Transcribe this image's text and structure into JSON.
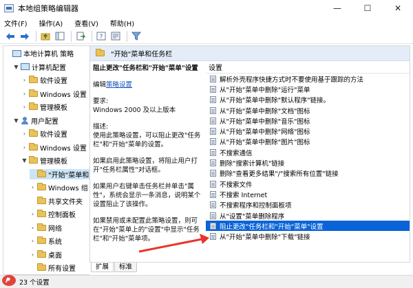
{
  "window": {
    "title": "本地组策略编辑器",
    "minimize": "—",
    "maximize": "☐",
    "close": "✕"
  },
  "menu": [
    "文件(F)",
    "操作(A)",
    "查看(V)",
    "帮助(H)"
  ],
  "toolbar": {
    "icons": [
      "back-arrow-icon",
      "forward-arrow-icon",
      "up-folder-icon",
      "show-hide-tree-icon",
      "export-list-icon",
      "help-icon",
      "properties-icon",
      "filter-icon"
    ]
  },
  "tree": {
    "items": [
      {
        "label": "本地计算机 策略",
        "indent": 0,
        "twisty": "",
        "icon": "pc"
      },
      {
        "label": "计算机配置",
        "indent": 1,
        "twisty": "▼",
        "icon": "pc"
      },
      {
        "label": "软件设置",
        "indent": 2,
        "twisty": "›",
        "icon": "folder"
      },
      {
        "label": "Windows 设置",
        "indent": 2,
        "twisty": "›",
        "icon": "folder"
      },
      {
        "label": "管理模板",
        "indent": 2,
        "twisty": "›",
        "icon": "folder"
      },
      {
        "label": "用户配置",
        "indent": 1,
        "twisty": "▼",
        "icon": "user"
      },
      {
        "label": "软件设置",
        "indent": 2,
        "twisty": "›",
        "icon": "folder"
      },
      {
        "label": "Windows 设置",
        "indent": 2,
        "twisty": "›",
        "icon": "folder"
      },
      {
        "label": "管理模板",
        "indent": 2,
        "twisty": "▼",
        "icon": "folder"
      },
      {
        "label": "\"开始\"菜单和",
        "indent": 3,
        "twisty": "",
        "icon": "folder",
        "selected": true
      },
      {
        "label": "Windows 组",
        "indent": 3,
        "twisty": "›",
        "icon": "folder"
      },
      {
        "label": "共享文件夹",
        "indent": 3,
        "twisty": "",
        "icon": "folder"
      },
      {
        "label": "控制面板",
        "indent": 3,
        "twisty": "›",
        "icon": "folder"
      },
      {
        "label": "网络",
        "indent": 3,
        "twisty": "›",
        "icon": "folder"
      },
      {
        "label": "系统",
        "indent": 3,
        "twisty": "›",
        "icon": "folder"
      },
      {
        "label": "桌面",
        "indent": 3,
        "twisty": "›",
        "icon": "folder"
      },
      {
        "label": "所有设置",
        "indent": 3,
        "twisty": "",
        "icon": "folder"
      }
    ]
  },
  "main": {
    "header": "\"开始\"菜单和任务栏",
    "desc_title": "阻止更改\"任务栏和\"开始\"菜单\"设置",
    "edit_prefix": "编辑",
    "edit_link": "策略设置",
    "req_label": "要求:",
    "req_value": "Windows 2000 及以上版本",
    "desc_label": "描述:",
    "desc_text": "使用此策略设置，可以阻止更改\"任务栏\"和\"开始\"菜单的设置。",
    "desc_p2": "如果启用此策略设置，将阻止用户打开\"任务栏属性\"对话框。",
    "desc_p3": "如果用户右键单击任务栏并单击\"属性\"，系统会显示一条消息，说明某个设置阻止了该操作。",
    "desc_p4": "如果禁用或未配置此策略设置，则可在\"开始\"菜单上的\"设置\"中显示\"任务栏\"和\"开始\"菜单项。",
    "list_header": "设置",
    "settings": [
      "解析外壳程序快捷方式时不要使用基于跟踪的方法",
      "从\"开始\"菜单中删除\"运行\"菜单",
      "从\"开始\"菜单中删除\"默认程序\"链接。",
      "从\"开始\"菜单中删除\"文档\"图标",
      "从\"开始\"菜单中删除\"音乐\"图标",
      "从\"开始\"菜单中删除\"网络\"图标",
      "从\"开始\"菜单中删除\"图片\"图标",
      "不搜索通信",
      "删除\"搜索计算机\"链接",
      "删除\"查看更多结果\"/\"搜索所有位置\"链接",
      "不搜索文件",
      "不搜索 Internet",
      "不搜索程序和控制面板项",
      "从\"设置\"菜单删除程序",
      "阻止更改\"任务栏和\"开始\"菜单\"设置",
      "从\"开始\"菜单中删除\"下载\"链接"
    ],
    "selected_index": 14
  },
  "tabs": [
    "扩展",
    "标准"
  ],
  "status": "23 个设置",
  "colors": {
    "selection": "#0a64d8",
    "arrow": "#e8342c",
    "header_bg": "#e4ecf7"
  }
}
